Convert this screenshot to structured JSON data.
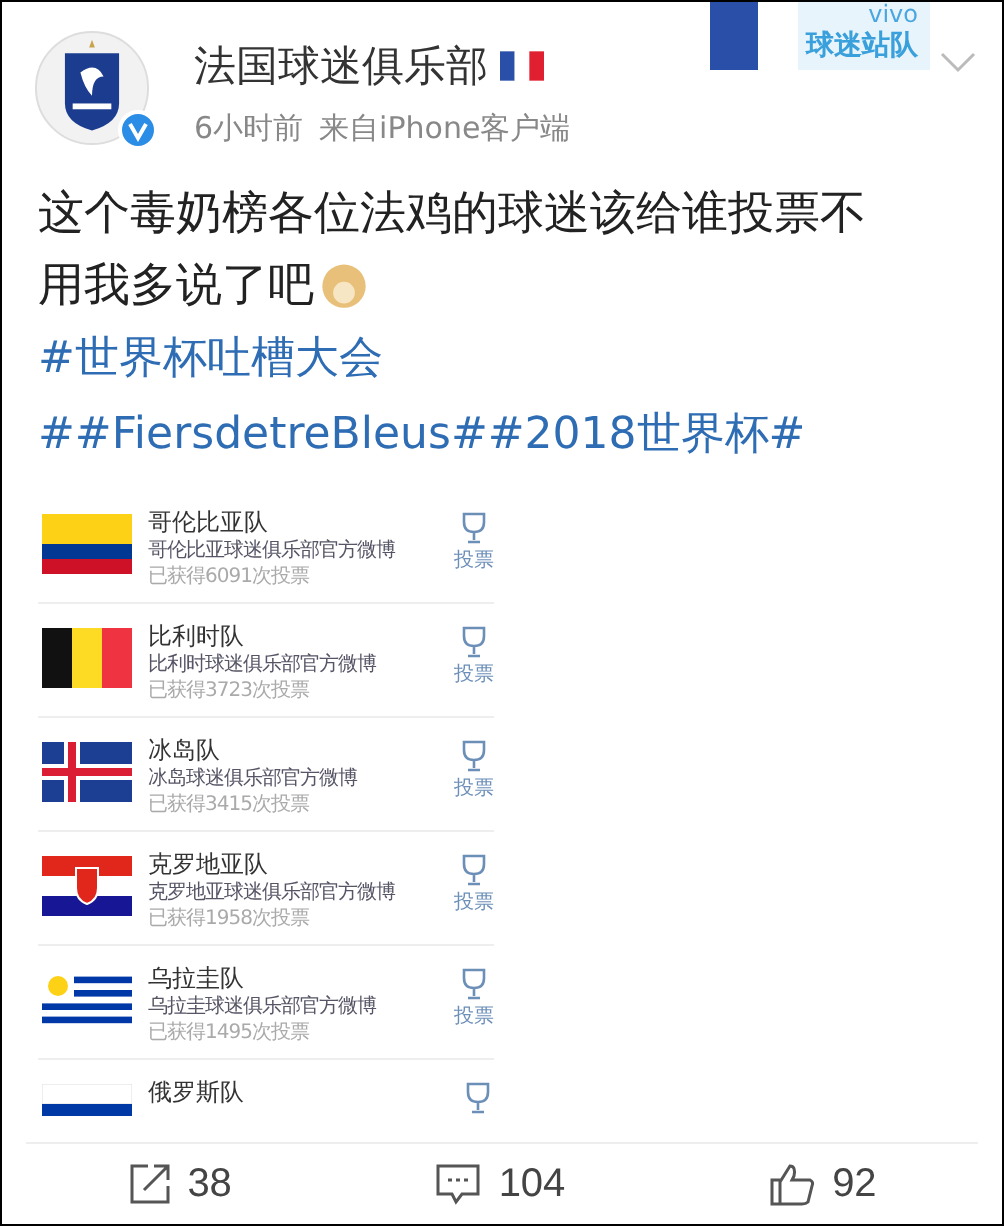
{
  "header": {
    "name": "法国球迷俱乐部",
    "verified": true,
    "time": "6小时前",
    "source_prefix": "来自",
    "source": "iPhone客户端",
    "badge_brand": "vivo",
    "badge": "球迷站队"
  },
  "post": {
    "text_lines": [
      "这个毒奶榜各位法鸡的球迷该给谁投票不",
      "用我多说了吧"
    ],
    "hashtags": [
      "#世界杯吐槽大会",
      "##FiersdetreBleus##2018世界杯#"
    ]
  },
  "teams": [
    {
      "kind": "colombia",
      "name": "哥伦比亚队",
      "sub": "哥伦比亚球迷俱乐部官方微博",
      "votes": "已获得6091次投票",
      "vote_label": "投票"
    },
    {
      "kind": "belgium",
      "name": "比利时队",
      "sub": "比利时球迷俱乐部官方微博",
      "votes": "已获得3723次投票",
      "vote_label": "投票"
    },
    {
      "kind": "iceland",
      "name": "冰岛队",
      "sub": "冰岛球迷俱乐部官方微博",
      "votes": "已获得3415次投票",
      "vote_label": "投票"
    },
    {
      "kind": "croatia",
      "name": "克罗地亚队",
      "sub": "克罗地亚球迷俱乐部官方微博",
      "votes": "已获得1958次投票",
      "vote_label": "投票"
    },
    {
      "kind": "uruguay",
      "name": "乌拉圭队",
      "sub": "乌拉圭球迷俱乐部官方微博",
      "votes": "已获得1495次投票",
      "vote_label": "投票"
    },
    {
      "kind": "russia",
      "name": "俄罗斯队"
    }
  ],
  "actions": [
    {
      "kind": "repost",
      "count": "38"
    },
    {
      "kind": "comment",
      "count": "104"
    },
    {
      "kind": "like",
      "count": "92"
    }
  ]
}
